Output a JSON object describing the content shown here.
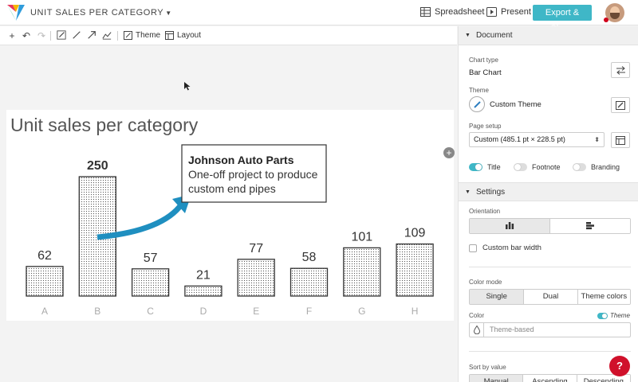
{
  "header": {
    "title": "UNIT SALES PER CATEGORY",
    "spreadsheet_label": "Spreadsheet",
    "present_label": "Present",
    "export_label": "Export & Share"
  },
  "toolbar": {
    "theme_label": "Theme",
    "layout_label": "Layout"
  },
  "chart_data": {
    "type": "bar",
    "title": "Unit sales per category",
    "categories": [
      "A",
      "B",
      "C",
      "D",
      "E",
      "F",
      "G",
      "H"
    ],
    "values": [
      62,
      250,
      57,
      21,
      77,
      58,
      101,
      109
    ],
    "highlight": "B",
    "ylim": [
      0,
      250
    ],
    "grid": false,
    "annotation": {
      "heading": "Johnson Auto Parts",
      "line1": "One-off project to produce",
      "line2": "custom end pipes"
    }
  },
  "panel": {
    "document_header": "Document",
    "chart_type_label": "Chart type",
    "chart_type_value": "Bar Chart",
    "theme_label": "Theme",
    "theme_value": "Custom Theme",
    "page_setup_label": "Page setup",
    "page_setup_value": "Custom (485.1 pt × 228.5 pt)",
    "toggles": {
      "title": "Title",
      "footnote": "Footnote",
      "branding": "Branding"
    },
    "settings_header": "Settings",
    "orientation_label": "Orientation",
    "custom_bar_width": "Custom bar width",
    "color_mode_label": "Color mode",
    "color_mode_options": [
      "Single",
      "Dual",
      "Theme colors"
    ],
    "color_label": "Color",
    "color_theme_toggle": "Theme",
    "color_placeholder": "Theme-based",
    "sort_label": "Sort by value",
    "sort_options": [
      "Manual",
      "Ascending",
      "Descending"
    ]
  },
  "help_label": "?",
  "colors": {
    "accent": "#3fb7c7",
    "arrow": "#1f8fc0",
    "help": "#d0112b"
  }
}
